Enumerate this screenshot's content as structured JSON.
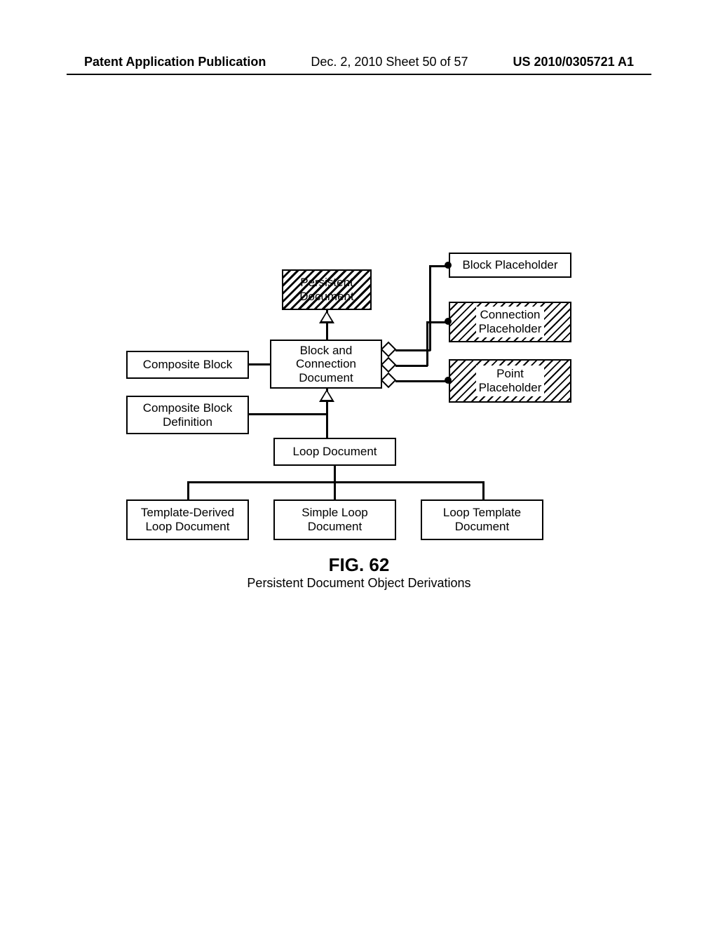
{
  "header": {
    "left": "Patent Application Publication",
    "center": "Dec. 2, 2010  Sheet 50 of 57",
    "right": "US 2010/0305721 A1"
  },
  "boxes": {
    "persistent_document": "Persistent\nDocument",
    "block_placeholder": "Block Placeholder",
    "connection_placeholder": "Connection\nPlaceholder",
    "point_placeholder": "Point\nPlaceholder",
    "composite_block": "Composite Block",
    "block_and_connection_document": "Block and\nConnection\nDocument",
    "composite_block_definition": "Composite Block\nDefinition",
    "loop_document": "Loop Document",
    "template_derived_loop_document": "Template-Derived\nLoop Document",
    "simple_loop_document": "Simple Loop\nDocument",
    "loop_template_document": "Loop Template\nDocument"
  },
  "caption": {
    "figure_number": "FIG. 62",
    "figure_title": "Persistent Document Object Derivations"
  }
}
